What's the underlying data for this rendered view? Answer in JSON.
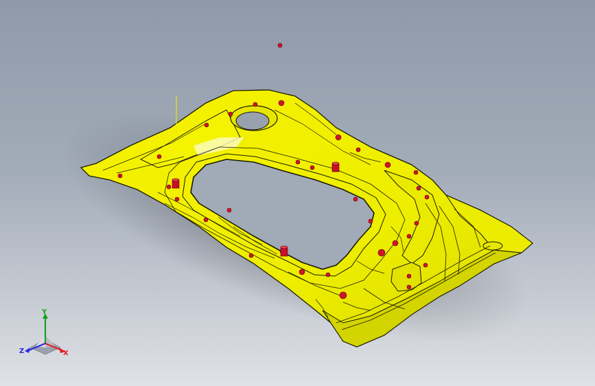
{
  "viewport": {
    "background_top": "#8f99a8",
    "background_bottom": "#dfe2e6"
  },
  "model": {
    "body_color": "#f2f200",
    "edge_color": "#1a1a00",
    "marker_color": "#d2142a"
  },
  "triad": {
    "x_label": "X",
    "y_label": "Y",
    "z_label": "Z",
    "x_color": "#e0202a",
    "y_color": "#1aa11a",
    "z_color": "#2a2ad8"
  }
}
